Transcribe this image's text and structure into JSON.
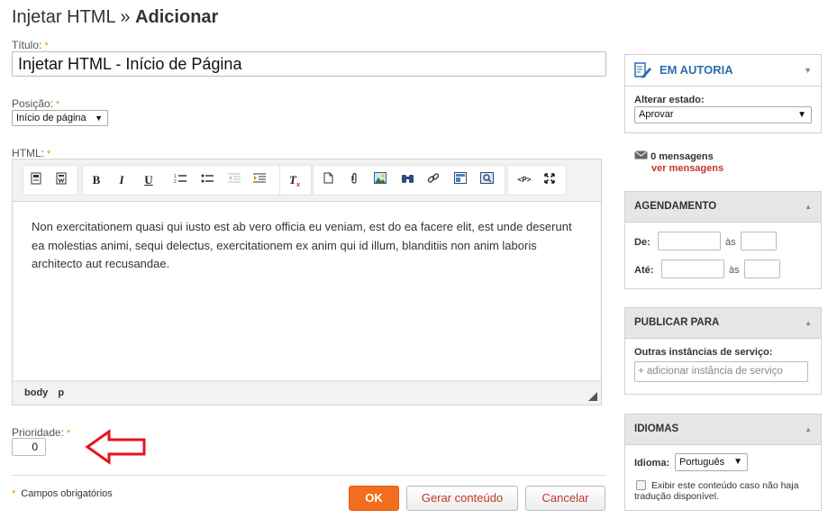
{
  "header": {
    "title_prefix": "Injetar HTML",
    "separator": "»",
    "title_main": "Adicionar"
  },
  "form": {
    "titulo_label": "Título:",
    "titulo_value": "Injetar HTML - Início de Página",
    "posicao_label": "Posição:",
    "posicao_value": "Início de página",
    "html_label": "HTML:",
    "required_mark": "*",
    "editor_content": "Non exercitationem quasi qui iusto est ab vero officia eu veniam, est do ea facere elit, est unde deserunt ea molestias animi, sequi delectus, exercitationem ex anim qui id illum, blanditiis non anim laboris architecto aut recusandae.",
    "path_body": "body",
    "path_p": "p",
    "prioridade_label": "Prioridade:",
    "prioridade_value": "0",
    "required_note": "Campos obrigatórios"
  },
  "toolbar": {
    "groups": [
      [
        "source-icon",
        "template-icon"
      ],
      [
        "bold-icon",
        "italic-icon",
        "underline-icon",
        "numbered-list-icon",
        "bulleted-list-icon",
        "outdent-icon",
        "indent-icon"
      ],
      [
        "remove-format-icon"
      ],
      [
        "new-page-icon",
        "attachment-icon",
        "image-icon",
        "find-icon",
        "link-icon",
        "embed-icon",
        "preview-icon"
      ],
      [
        "show-blocks-icon",
        "maximize-icon"
      ]
    ],
    "bold": "B",
    "italic": "I",
    "underline": "U",
    "remove_format": "T",
    "show_blocks": "<P>"
  },
  "buttons": {
    "ok": "OK",
    "generate": "Gerar conteúdo",
    "cancel": "Cancelar"
  },
  "sidebar": {
    "status": {
      "title": "EM AUTORIA",
      "change_label": "Alterar estado:",
      "change_value": "Aprovar"
    },
    "messages": {
      "count_text": "0 mensagens",
      "link": "ver mensagens"
    },
    "scheduling": {
      "title": "AGENDAMENTO",
      "from_label": "De:",
      "to_label": "Até:",
      "at_label": "às"
    },
    "publish": {
      "title": "PUBLICAR PARA",
      "label": "Outras instâncias de serviço:",
      "placeholder": "+ adicionar instância de serviço"
    },
    "languages": {
      "title": "IDIOMAS",
      "label": "Idioma:",
      "value": "Português",
      "checkbox_text": "Exibir este conteúdo caso não haja tradução disponível."
    }
  },
  "colors": {
    "accent_orange": "#f26e1e",
    "link_red": "#c0392b",
    "title_blue": "#2a6fb0",
    "annotation_arrow": "#e8121a"
  }
}
